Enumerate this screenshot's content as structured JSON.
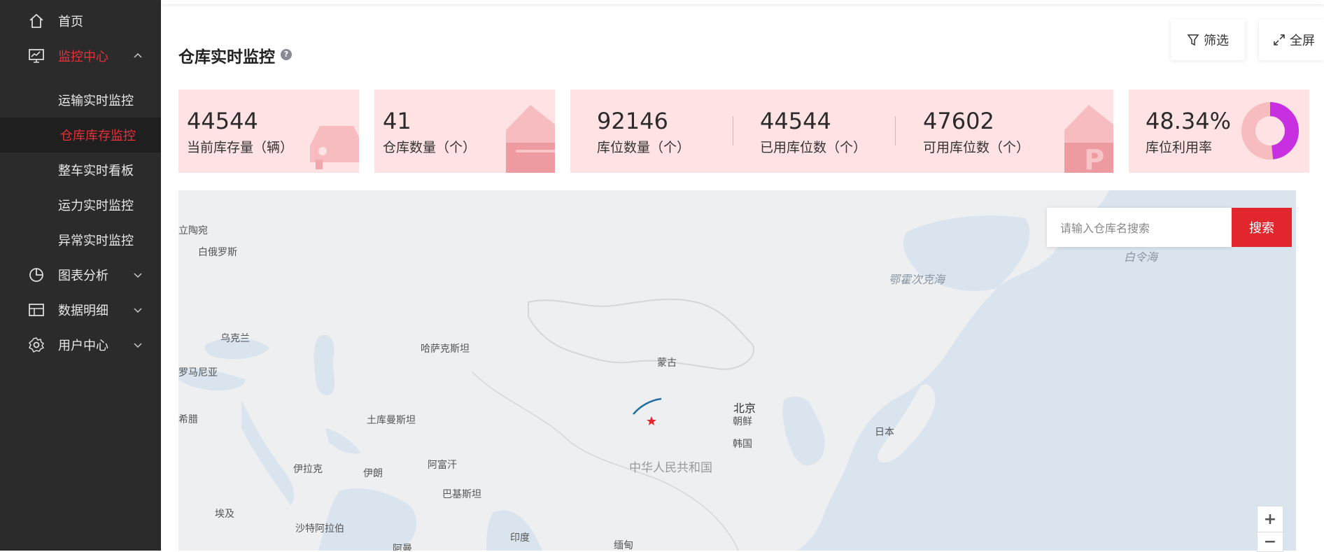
{
  "sidebar": {
    "items": [
      {
        "label": "首页",
        "icon": "home-icon"
      },
      {
        "label": "监控中心",
        "icon": "monitor-icon"
      },
      {
        "label": "图表分析",
        "icon": "pie-chart-icon"
      },
      {
        "label": "数据明细",
        "icon": "table-icon"
      },
      {
        "label": "用户中心",
        "icon": "gear-icon"
      }
    ],
    "sub_items": [
      {
        "label": "运输实时监控"
      },
      {
        "label": "仓库库存监控"
      },
      {
        "label": "整车实时看板"
      },
      {
        "label": "运力实时监控"
      },
      {
        "label": "异常实时监控"
      }
    ],
    "accent_color": "#e8303a"
  },
  "header": {
    "title": "仓库实时监控",
    "help_icon": "?",
    "filter_label": "筛选",
    "fullscreen_label": "全屏"
  },
  "stats": {
    "inventory": {
      "value": "44544",
      "caption": "当前库存量（辆）"
    },
    "warehouses": {
      "value": "41",
      "caption": "仓库数量（个）"
    },
    "slots": {
      "value": "92146",
      "caption": "库位数量（个）"
    },
    "used_slots": {
      "value": "44544",
      "caption": "已用库位数（个）"
    },
    "free_slots": {
      "value": "47602",
      "caption": "可用库位数（个）"
    },
    "utilization": {
      "value": "48.34%",
      "caption": "库位利用率",
      "fraction": 0.4834
    }
  },
  "map": {
    "search_placeholder": "请输入仓库名搜索",
    "search_button": "搜索",
    "zoom_in": "+",
    "zoom_out": "−",
    "labels": {
      "lithuania": "立陶宛",
      "belarus": "白俄罗斯",
      "ukraine": "乌克兰",
      "romania": "罗马尼亚",
      "greece": "希腊",
      "kazakhstan": "哈萨克斯坦",
      "mongolia": "蒙古",
      "turkmenistan": "土库曼斯坦",
      "iraq": "伊拉克",
      "iran": "伊朗",
      "afghanistan": "阿富汗",
      "pakistan": "巴基斯坦",
      "egypt": "埃及",
      "saudi": "沙特阿拉伯",
      "india": "印度",
      "myanmar": "缅甸",
      "oman": "阿曼",
      "china": "中华人民共和国",
      "beijing": "北京",
      "north_korea": "朝鲜",
      "south_korea": "韩国",
      "japan": "日本",
      "okhotsk": "鄂霍次克海",
      "bering": "白令海"
    }
  }
}
